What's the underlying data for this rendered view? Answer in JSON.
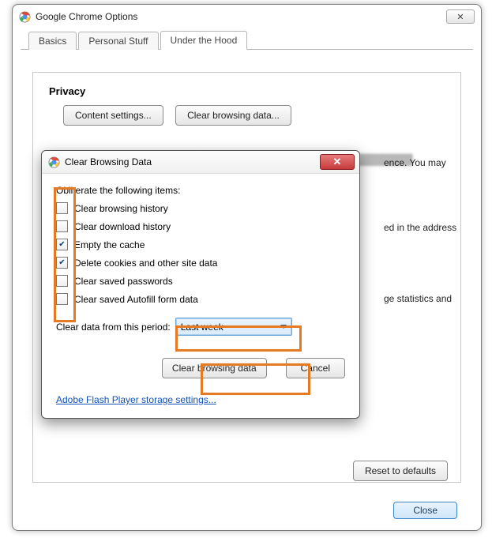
{
  "main": {
    "title": "Google Chrome Options",
    "close_glyph": "✕",
    "tabs": {
      "basics": "Basics",
      "personal": "Personal Stuff",
      "hood": "Under the Hood"
    },
    "privacy": {
      "title": "Privacy",
      "content_settings": "Content settings...",
      "clear_data": "Clear browsing data..."
    },
    "bg_frag1": "ence. You may",
    "bg_frag2": "ed in the address",
    "bg_frag3": "ge statistics and",
    "reset": "Reset to defaults",
    "close": "Close"
  },
  "dialog": {
    "title": "Clear Browsing Data",
    "close_glyph": "✕",
    "obliterate": "Obliterate the following items:",
    "items": [
      {
        "label": "Clear browsing history",
        "checked": false
      },
      {
        "label": "Clear download history",
        "checked": false
      },
      {
        "label": "Empty the cache",
        "checked": true
      },
      {
        "label": "Delete cookies and other site data",
        "checked": true
      },
      {
        "label": "Clear saved passwords",
        "checked": false
      },
      {
        "label": "Clear saved Autofill form data",
        "checked": false
      }
    ],
    "period_label": "Clear data from this period:",
    "period_value": "Last week",
    "clear_btn": "Clear browsing data",
    "cancel_btn": "Cancel",
    "flash_link": "Adobe Flash Player storage settings..."
  }
}
